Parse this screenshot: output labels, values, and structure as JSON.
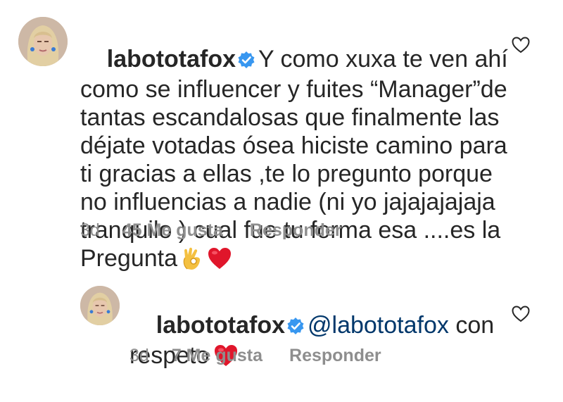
{
  "comments": [
    {
      "username": "labototafox",
      "text_lines": [
        "Y como xuxa te ven ahí",
        "como se influencer y fuites “Manager”de",
        "tantas escandalosas que finalmente las",
        "déjate votadas ósea hiciste camino para",
        "ti gracias a ellas ,te lo pregunto porque",
        "no influencias a nadie (ni yo jajajajajaja",
        "tranquilo ) cual fue tu forma esa ....es la",
        "Pregunta"
      ],
      "time": "3d",
      "likes": "45 Me gusta",
      "reply": "Responder"
    },
    {
      "username": "labototafox",
      "mention": "@labototafox",
      "text_first": "con",
      "text_second": "respeto",
      "time": "3d",
      "likes": "7 Me gusta",
      "reply": "Responder"
    }
  ],
  "icons": {
    "verified": "verified-badge-icon",
    "like": "heart-outline-icon",
    "ok_emoji": "ok-hand-emoji",
    "red_heart_emoji": "red-heart-emoji"
  },
  "colors": {
    "text": "#262626",
    "meta": "#8e8e8e",
    "mention": "#00376b",
    "verified": "#3897f0",
    "heart_emoji": "#e0162b"
  }
}
